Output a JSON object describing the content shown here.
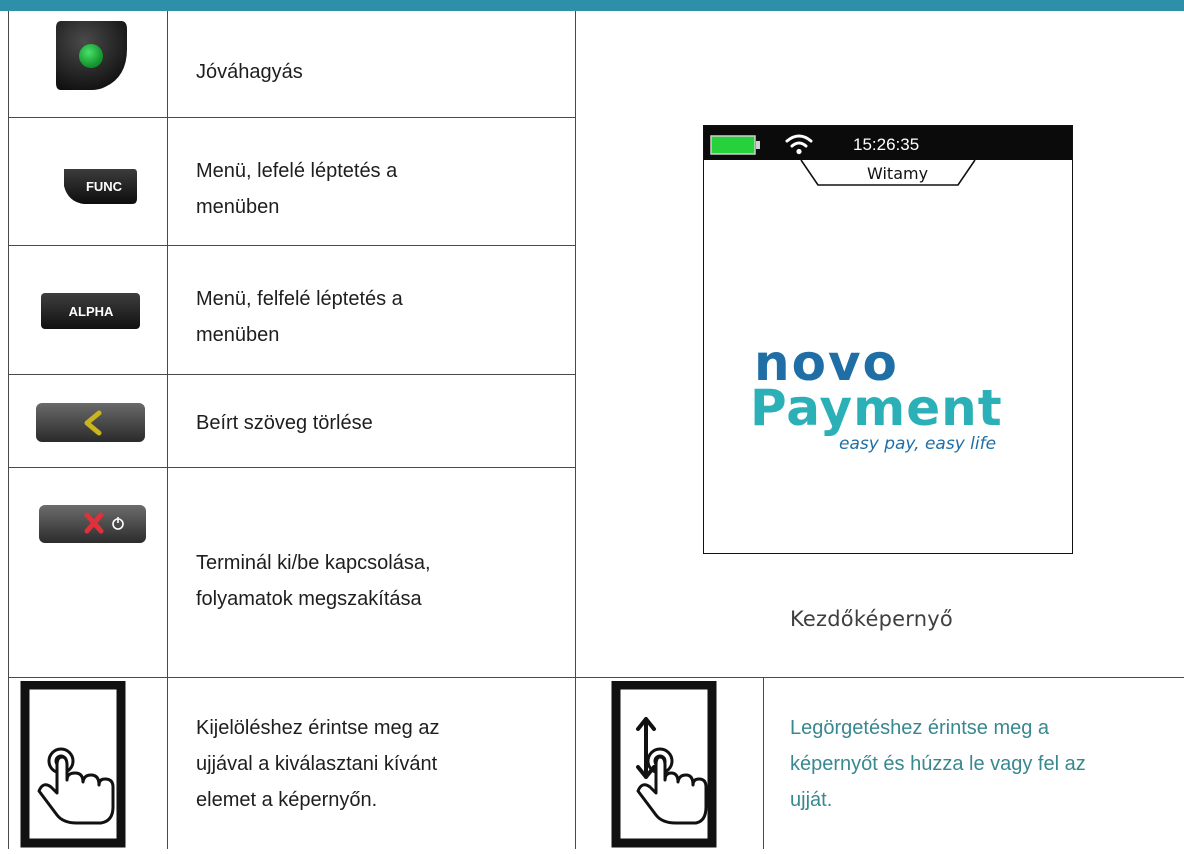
{
  "keys": [
    {
      "icon": "green-confirm-key-icon",
      "label": "Jóváhagyás"
    },
    {
      "icon": "func-key-icon",
      "key_text": "FUNC",
      "label_line1": "Menü, lefelé léptetés a",
      "label_line2": "menüben"
    },
    {
      "icon": "alpha-key-icon",
      "key_text": "ALPHA",
      "label_line1": "Menü, felfelé léptetés a",
      "label_line2": "menüben"
    },
    {
      "icon": "backspace-key-icon",
      "label": "Beírt szöveg törlése"
    },
    {
      "icon": "cancel-power-key-icon",
      "label_line1": "Terminál ki/be kapcsolása,",
      "label_line2": "folyamatok megszakítása"
    }
  ],
  "start_screen": {
    "time": "15:26:35",
    "tab_label": "Witamy",
    "logo_line1": "novo",
    "logo_line2": "Payment",
    "tagline": "easy pay, easy life",
    "caption": "Kezdőképernyő"
  },
  "gestures": [
    {
      "icon": "tap-finger-icon",
      "line1": "Kijelöléshez érintse meg az",
      "line2": "ujjával a kiválasztani kívánt",
      "line3": "elemet a képernyőn."
    },
    {
      "icon": "scroll-finger-icon",
      "line1": "Legörgetéshez érintse meg a",
      "line2": "képernyőt és húzza le vagy fel az",
      "line3": "ujját."
    }
  ],
  "colors": {
    "header_bar": "#2e8fa8",
    "gesture_text": "#37888f",
    "logo_blue": "#1f6fa6",
    "logo_teal": "#2ab0b6",
    "battery_green": "#27d13c"
  }
}
